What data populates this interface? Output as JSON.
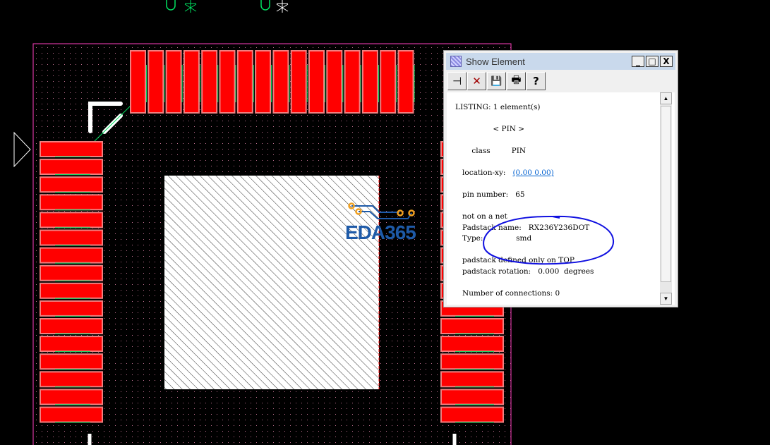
{
  "dialog": {
    "title": "Show Element",
    "window_buttons": {
      "minimize": "_",
      "maximize": "□",
      "close": "X"
    },
    "toolbar": [
      {
        "name": "pin-icon",
        "glyph": "⊣"
      },
      {
        "name": "delete-icon",
        "glyph": "✕"
      },
      {
        "name": "save-icon",
        "glyph": "💾"
      },
      {
        "name": "print-icon",
        "glyph": "🖶"
      },
      {
        "name": "help-icon",
        "glyph": "?"
      }
    ],
    "listing": "LISTING: 1 element(s)",
    "element_type": "< PIN >",
    "class_label": "class",
    "class_value": "PIN",
    "location_label": "location-xy:",
    "location_value": "(0.00 0.00)",
    "pin_number_label": "pin number:",
    "pin_number": "65",
    "net_status": "not on a net",
    "padstack_name_label": "Padstack name:",
    "padstack_name": "RX236Y236DOT",
    "type_label": "Type:",
    "type_value": "smd",
    "padstack_layer": "padstack defined only on TOP",
    "rotation_label": "padstack rotation:",
    "rotation_value": "0.000",
    "rotation_unit": "degrees",
    "connections_label": "Number of connections:",
    "connections": "0"
  },
  "watermark": "EDA365",
  "colors": {
    "pad": "#ff0000",
    "pad_border": "#f08080",
    "board_outline": "#ff40c0",
    "ratsnest": "#00e060",
    "annotation": "#1010e0"
  }
}
